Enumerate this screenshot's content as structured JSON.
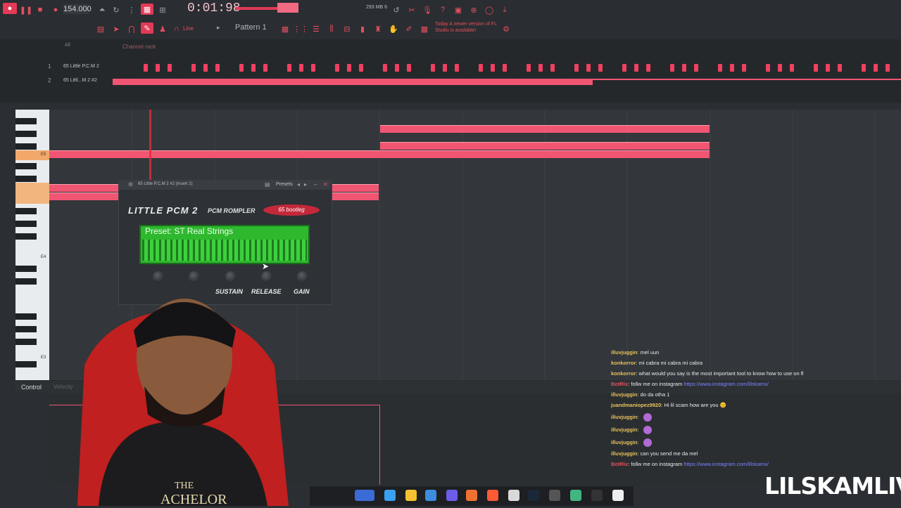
{
  "toolbar": {
    "tempo": "154.000",
    "time": "0:01:98",
    "pattern": "Pattern 1",
    "snap": "Line",
    "memory": "293 MB\n6",
    "news": "Today  A newer version of FL Studio is available!"
  },
  "channel_rack": {
    "title": "Channel rack",
    "filter": "All",
    "channels": [
      {
        "num": "1",
        "name": "65 Little P.C.M 2"
      },
      {
        "num": "2",
        "name": "65 Littl...M 2 #2"
      }
    ]
  },
  "piano_roll": {
    "key_labels": [
      "E5",
      "E4",
      "E3"
    ],
    "control_label": "Control",
    "control_sub": "Velocity"
  },
  "plugin": {
    "title": "65 Little P.C.M 2 #2 (Insert 2)",
    "presets_label": "Presets",
    "name": "LITTLE PCM 2",
    "subtitle": "PCM ROMPLER",
    "brand": "65 bootleg",
    "preset_text": "Preset: ST Real Strings",
    "knobs": [
      "SUSTAIN",
      "RELEASE",
      "GAIN"
    ]
  },
  "chat": {
    "messages": [
      {
        "user": "illuvjuggin",
        "text": ": mel uun"
      },
      {
        "user": "konkorror",
        "text": ": mi cabra mi cabra mi cabra"
      },
      {
        "user": "konkorror",
        "text": ": what would you say is the most important tool to know how to use on fl"
      },
      {
        "user": "BotRix",
        "text": ": follw me on instagram ",
        "link": "https://www.instagram.com/lilskamx/"
      },
      {
        "user": "illuvjuggin",
        "text": ": do da otha 1"
      },
      {
        "user": "juandmaniopez9920",
        "text": ": Hi lil scam how are you 😊"
      },
      {
        "user": "illuvjuggin",
        "text": ":"
      },
      {
        "user": "illuvjuggin",
        "text": ":"
      },
      {
        "user": "illuvjuggin",
        "text": ":"
      },
      {
        "user": "illuvjuggin",
        "text": ": can you send me da mel"
      },
      {
        "user": "BotRix",
        "text": ": follw me on instagram ",
        "link": "https://www.instagram.com/lilskamx/"
      }
    ]
  },
  "webcam": {
    "shirt_text_1": "THE",
    "shirt_text_2": "ACHELOR"
  },
  "watermark": "LILSKAMLIVE",
  "colors": {
    "accent": "#f05572",
    "lcd": "#2eb82e",
    "bg": "#2b2f33"
  }
}
